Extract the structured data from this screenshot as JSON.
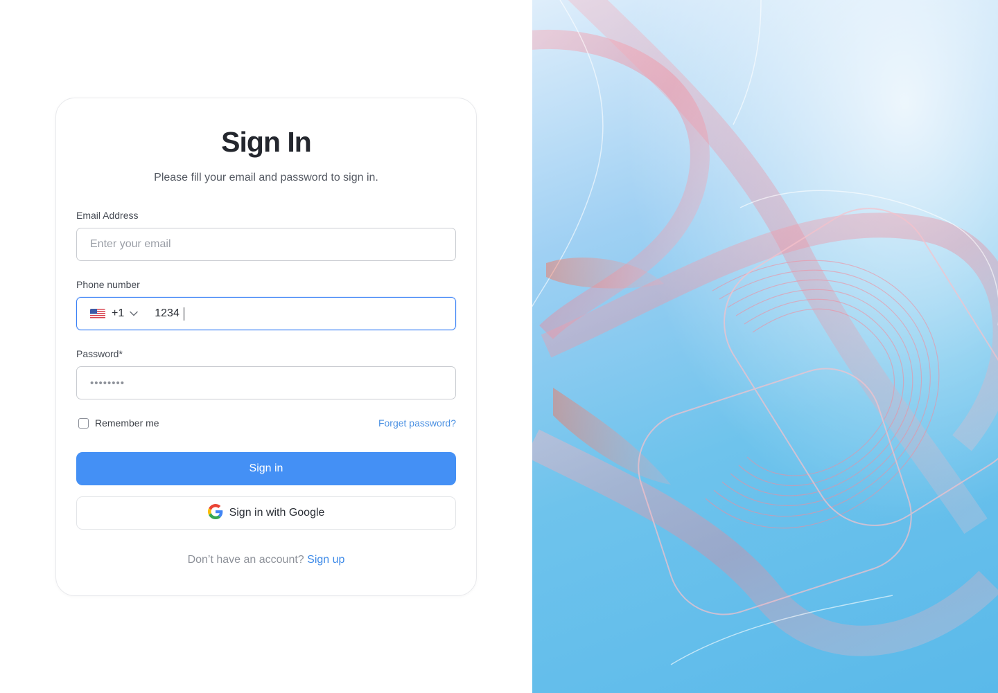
{
  "signin": {
    "title": "Sign In",
    "subtitle": "Please fill your email and password to sign in.",
    "email": {
      "label": "Email Address",
      "placeholder": "Enter your email",
      "value": ""
    },
    "phone": {
      "label": "Phone number",
      "country_code": "+1",
      "country_flag": "us-flag-icon",
      "value": "1234"
    },
    "password": {
      "label": "Password*",
      "masked_value": "••••••••"
    },
    "remember_label": "Remember me",
    "remember_checked": false,
    "forgot_label": "Forget password?",
    "signin_button": "Sign in",
    "google_button": "Sign in with Google",
    "signup_prompt": "Don’t have an account?",
    "signup_link": "Sign up"
  },
  "colors": {
    "primary": "#4490f5",
    "link": "#3d8ae8",
    "focus_border": "#3b82f6",
    "hero_sky": "#6ec3ec",
    "hero_ribbon": "#f07a8c"
  }
}
